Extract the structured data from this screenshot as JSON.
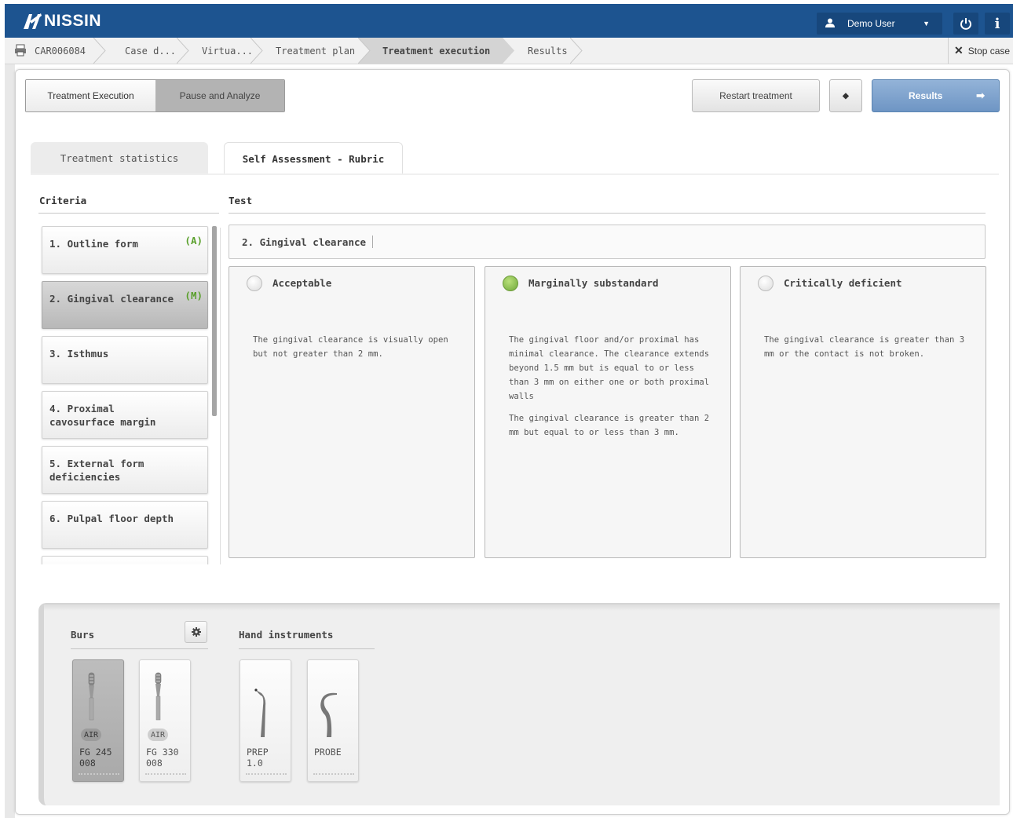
{
  "header": {
    "brand": "NISSIN",
    "user_name": "Demo User"
  },
  "breadcrumb": {
    "case_id": "CAR006084",
    "items": [
      "Case d...",
      "Virtua...",
      "Treatment plan",
      "Treatment execution",
      "Results"
    ],
    "stop_label": "Stop case"
  },
  "toolbar": {
    "mode_options": [
      "Treatment Execution",
      "Pause and Analyze"
    ],
    "restart_label": "Restart treatment",
    "results_label": "Results"
  },
  "tabs": [
    "Treatment statistics",
    "Self Assessment - Rubric"
  ],
  "rubric": {
    "criteria_header": "Criteria",
    "test_header": "Test",
    "criteria": [
      {
        "label": "1. Outline form",
        "grade": "(A)"
      },
      {
        "label": "2. Gingival clearance",
        "grade": "(M)"
      },
      {
        "label": "3. Isthmus",
        "grade": ""
      },
      {
        "label": "4. Proximal cavosurface margin",
        "grade": ""
      },
      {
        "label": "5. External form deficiencies",
        "grade": ""
      },
      {
        "label": "6. Pulpal floor depth",
        "grade": ""
      }
    ],
    "selected_criterion": "2. Gingival clearance",
    "options": [
      {
        "title": "Acceptable",
        "selected": false,
        "desc": [
          "The gingival clearance is visually open but not greater than 2 mm."
        ]
      },
      {
        "title": "Marginally substandard",
        "selected": true,
        "desc": [
          "The gingival floor and/or proximal has minimal clearance. The clearance extends beyond 1.5 mm but is equal to or less than 3 mm on either one or both proximal walls",
          "The gingival clearance is greater than 2 mm but equal to or less than 3 mm."
        ]
      },
      {
        "title": "Critically deficient",
        "selected": false,
        "desc": [
          "The gingival clearance is greater than 3 mm or the contact is not broken."
        ]
      }
    ]
  },
  "instruments": {
    "burs_label": "Burs",
    "hand_label": "Hand instruments",
    "burs": [
      {
        "badge": "AIR",
        "name": "FG 245\n008",
        "selected": true
      },
      {
        "badge": "AIR",
        "name": "FG 330\n008",
        "selected": false
      }
    ],
    "hand": [
      {
        "name": "PREP\n1.0"
      },
      {
        "name": "PROBE"
      }
    ]
  },
  "colors": {
    "header_bg": "#1d5490",
    "accent_green": "#5aa02c",
    "results_btn": "#7fa2cf"
  }
}
